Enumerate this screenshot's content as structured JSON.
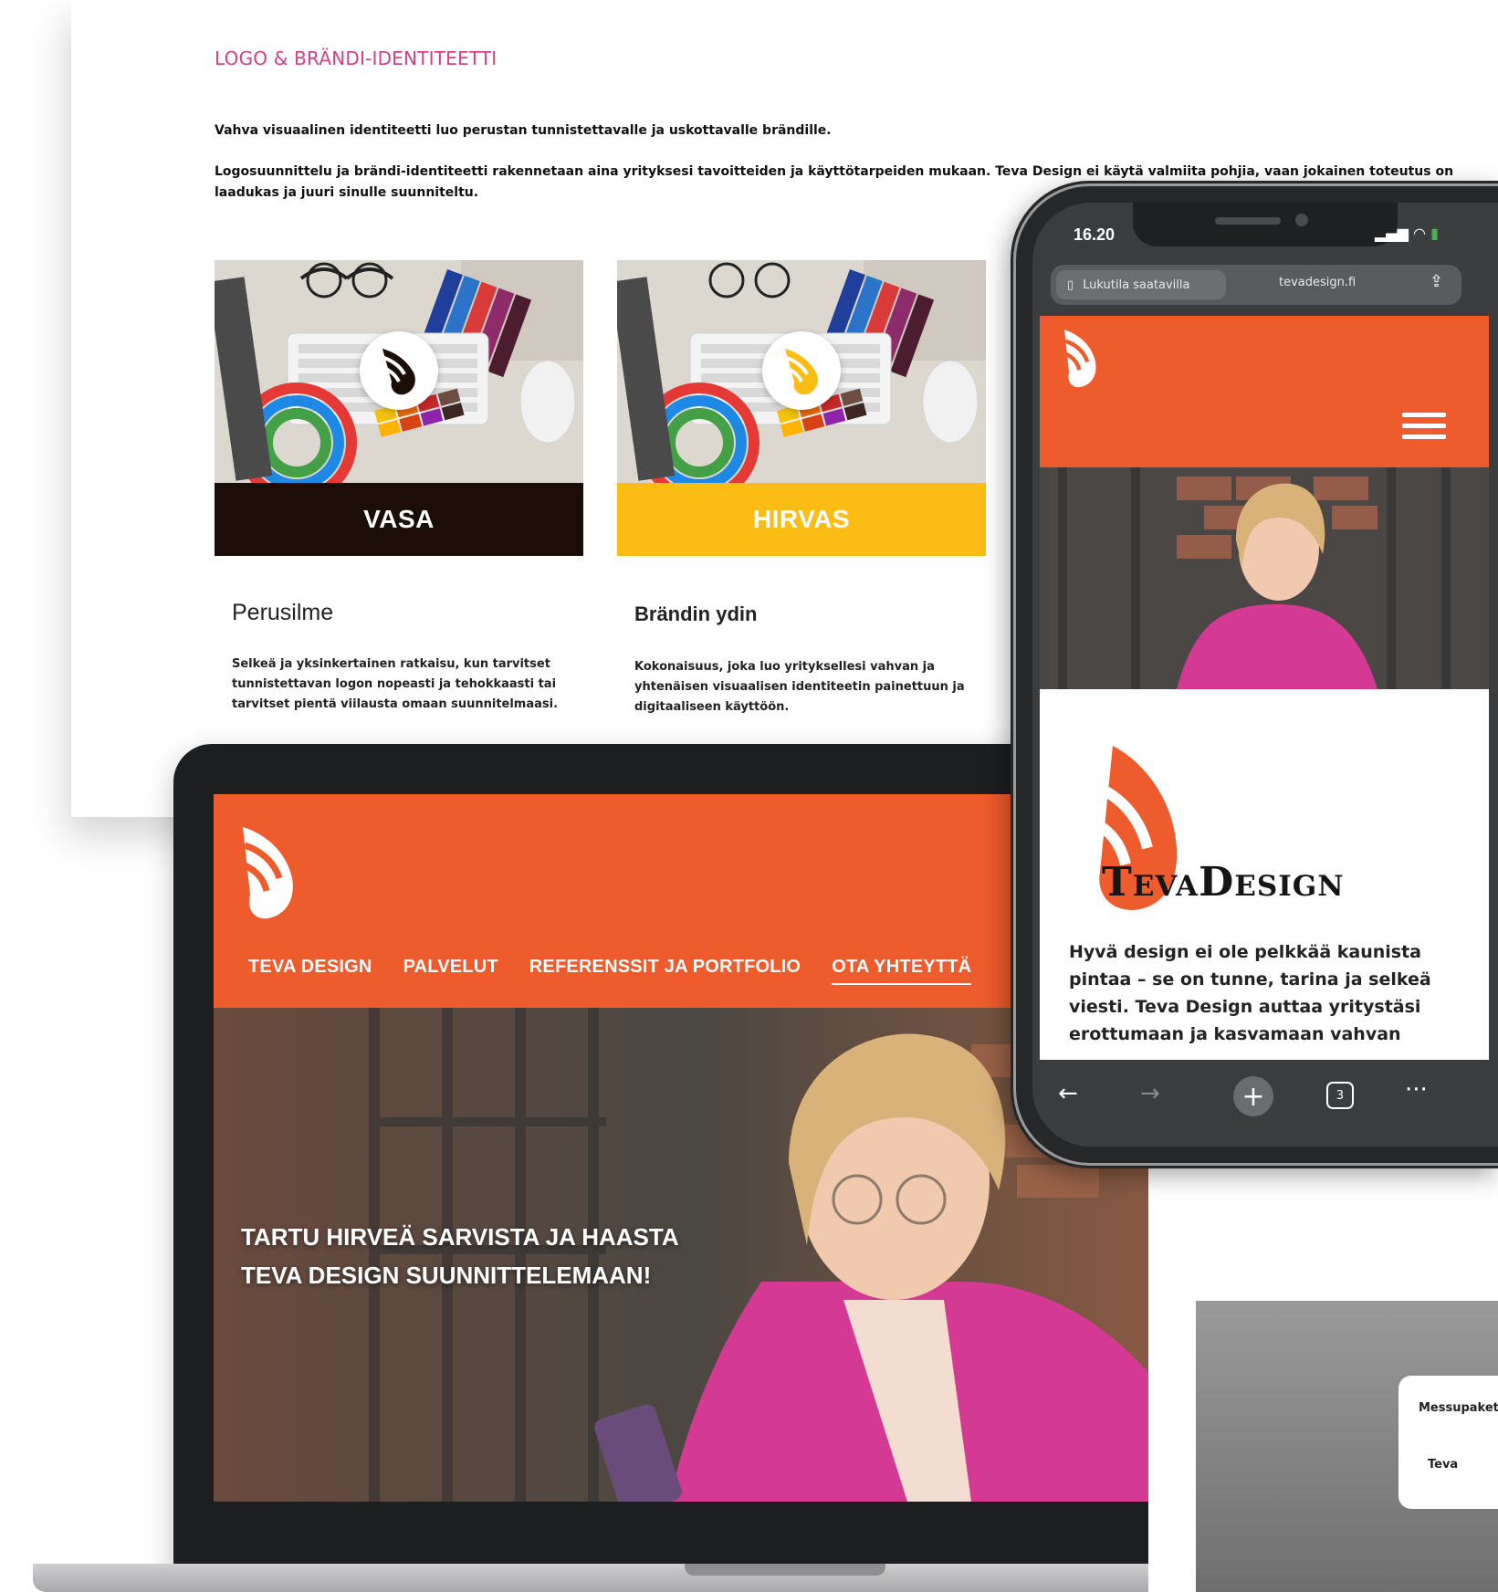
{
  "document": {
    "kicker": "LOGO & BRÄNDI-IDENTITEETTI",
    "lead": "Vahva visuaalinen identiteetti luo perustan tunnistettavalle ja uskottavalle brändille.",
    "body": "Logosuunnittelu ja brändi-identiteetti rakennetaan aina yrityksesi tavoitteiden ja käyttötarpeiden mukaan. Teva Design ei käytä valmiita pohjia, vaan jokainen toteutus on laadukas ja juuri sinulle suunniteltu.",
    "packages": [
      {
        "band_label": "VASA",
        "band_color": "#1c0d09",
        "title": "Perusilme",
        "description": "Selkeä ja yksinkertainen ratkaisu, kun tarvitset tunnistettavan logon nopeasti ja tehokkaasti tai tarvitset pientä viilausta omaan suunnitelmaasi."
      },
      {
        "band_label": "HIRVAS",
        "band_color": "#fbbd14",
        "title": "Brändin ydin",
        "description": "Kokonaisuus, joka luo yrityksellesi vahvan ja yhtenäisen visuaalisen identiteetin painettuun ja digitaaliseen käyttöön."
      }
    ]
  },
  "laptop_site": {
    "brand_color": "#ee5b2c",
    "nav": [
      "TEVA DESIGN",
      "PALVELUT",
      "REFERENSSIT JA PORTFOLIO",
      "OTA YHTEYTTÄ"
    ],
    "hero_line1": "TARTU HIRVEÄ SARVISTA JA HAASTA",
    "hero_line2": "TEVA DESIGN SUUNNITTELEMAAN!"
  },
  "phone": {
    "time": "16.20",
    "reader_label": "Lukutila saatavilla",
    "domain": "tevadesign.fi",
    "tab_count": "3",
    "wordmark": "TevaDesign",
    "copy": "Hyvä design ei ole pelkkää kaunista pintaa – se on tunne, tarina ja selkeä viesti. Teva Design auttaa yritystäsi erottumaan ja kasvamaan vahvan"
  },
  "popup": {
    "title": "Messupaket",
    "subtitle": "Teva"
  }
}
